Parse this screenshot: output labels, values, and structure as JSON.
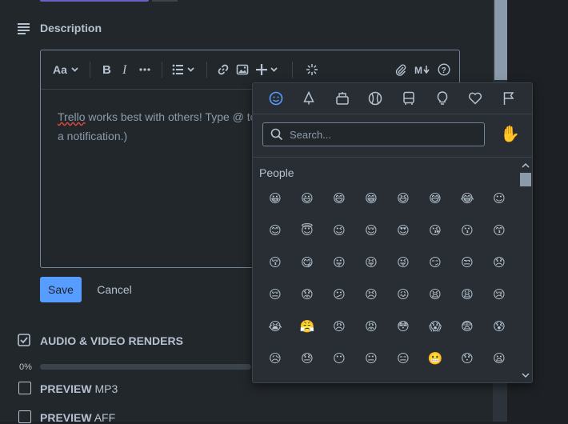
{
  "description": {
    "title": "Description"
  },
  "editor": {
    "text_part1": "Trello",
    "text_part2": " works best with others! Type @ to",
    "text_line2": "a notification.)"
  },
  "buttons": {
    "save": "Save",
    "cancel": "Cancel"
  },
  "checklist": {
    "title": "AUDIO & VIDEO RENDERS",
    "progress_label": "0%",
    "progress": 0,
    "items": [
      {
        "bold": "PREVIEW",
        "rest": " MP3"
      },
      {
        "bold": "PREVIEW",
        "rest": " AFF"
      }
    ]
  },
  "picker": {
    "categories": [
      "smiley-icon",
      "tree-icon",
      "food-icon",
      "ball-icon",
      "bus-icon",
      "bulb-icon",
      "heart-icon",
      "flag-icon"
    ],
    "search_placeholder": "Search...",
    "skin_tone_icon": "✋",
    "section_title": "People",
    "emojis": [
      [
        "😀",
        "😃",
        "😄",
        "😁",
        "😆",
        "😅",
        "😂",
        "☺"
      ],
      [
        "😊",
        "😇",
        "😉",
        "😌",
        "😍",
        "😘",
        "😗",
        "😙"
      ],
      [
        "😚",
        "😋",
        "😛",
        "😝",
        "😜",
        "😏",
        "😒",
        "😞"
      ],
      [
        "😔",
        "😟",
        "😕",
        "😣",
        "😖",
        "😫",
        "😩",
        "😢"
      ],
      [
        "😭",
        "😤",
        "😠",
        "😡",
        "😳",
        "😱",
        "😨",
        "😰"
      ],
      [
        "😥",
        "😓",
        "😶",
        "😐",
        "😑",
        "😬",
        "😯",
        "😦"
      ]
    ]
  },
  "colors": {
    "accent": "#579dff",
    "background": "#22272b",
    "header_purple": "#6e5dc6"
  }
}
